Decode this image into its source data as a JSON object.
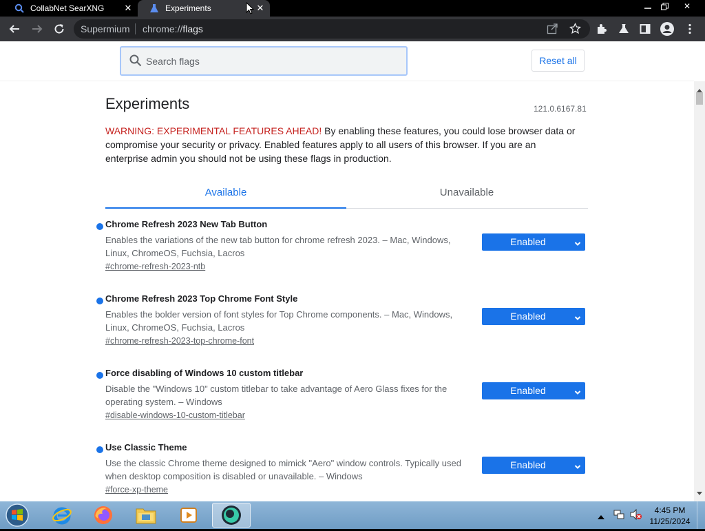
{
  "browser": {
    "tabs": [
      {
        "title": "CollabNet SearXNG",
        "icon": "search-favicon"
      },
      {
        "title": "Experiments",
        "icon": "flask-favicon",
        "active": true
      }
    ],
    "omnibox": {
      "chip": "Supermium",
      "url_prefix": "chrome://",
      "url_host": "flags"
    }
  },
  "flags_page": {
    "search_placeholder": "Search flags",
    "reset_label": "Reset all",
    "title": "Experiments",
    "version": "121.0.6167.81",
    "warning_lead": "WARNING: EXPERIMENTAL FEATURES AHEAD!",
    "warning_body": " By enabling these features, you could lose browser data or compromise your security or privacy. Enabled features apply to all users of this browser. If you are an enterprise admin you should not be using these flags in production.",
    "tabs": {
      "available": "Available",
      "unavailable": "Unavailable"
    },
    "flags": [
      {
        "name": "Chrome Refresh 2023 New Tab Button",
        "description": "Enables the variations of the new tab button for chrome refresh 2023. – Mac, Windows, Linux, ChromeOS, Fuchsia, Lacros",
        "link": "#chrome-refresh-2023-ntb",
        "value": "Enabled"
      },
      {
        "name": "Chrome Refresh 2023 Top Chrome Font Style",
        "description": "Enables the bolder version of font styles for Top Chrome components. – Mac, Windows, Linux, ChromeOS, Fuchsia, Lacros",
        "link": "#chrome-refresh-2023-top-chrome-font",
        "value": "Enabled"
      },
      {
        "name": "Force disabling of Windows 10 custom titlebar",
        "description": "Disable the \"Windows 10\" custom titlebar to take advantage of Aero Glass fixes for the operating system. – Windows",
        "link": "#disable-windows-10-custom-titlebar",
        "value": "Enabled"
      },
      {
        "name": "Use Classic Theme",
        "description": "Use the classic Chrome theme designed to mimick \"Aero\" window controls. Typically used when desktop composition is disabled or unavailable. – Windows",
        "link": "#force-xp-theme",
        "value": "Enabled"
      }
    ]
  },
  "taskbar": {
    "apps": [
      "internet-explorer",
      "firefox",
      "file-explorer",
      "media-player",
      "supermium"
    ],
    "time": "4:45 PM",
    "date": "11/25/2024"
  },
  "colors": {
    "accent": "#1a73e8",
    "warning": "#c5221f"
  }
}
